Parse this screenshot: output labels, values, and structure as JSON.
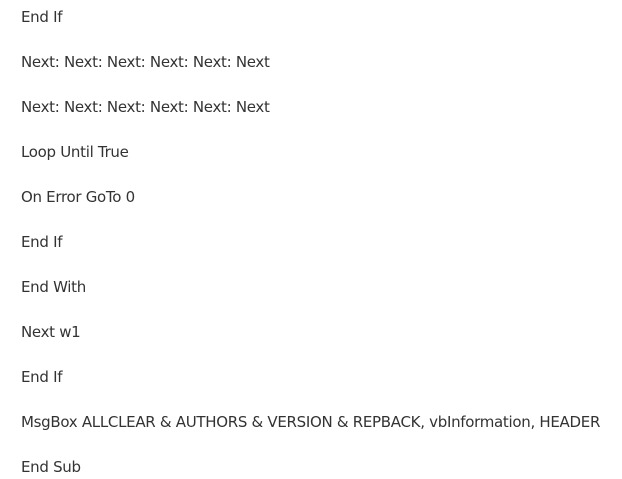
{
  "code_lines": [
    "End If",
    "Next: Next: Next: Next: Next: Next",
    "Next: Next: Next: Next: Next: Next",
    "Loop Until True",
    "On Error GoTo 0",
    "End If",
    "End With",
    "Next w1",
    "End If",
    "MsgBox ALLCLEAR & AUTHORS & VERSION & REPBACK, vbInformation, HEADER",
    "End Sub"
  ]
}
